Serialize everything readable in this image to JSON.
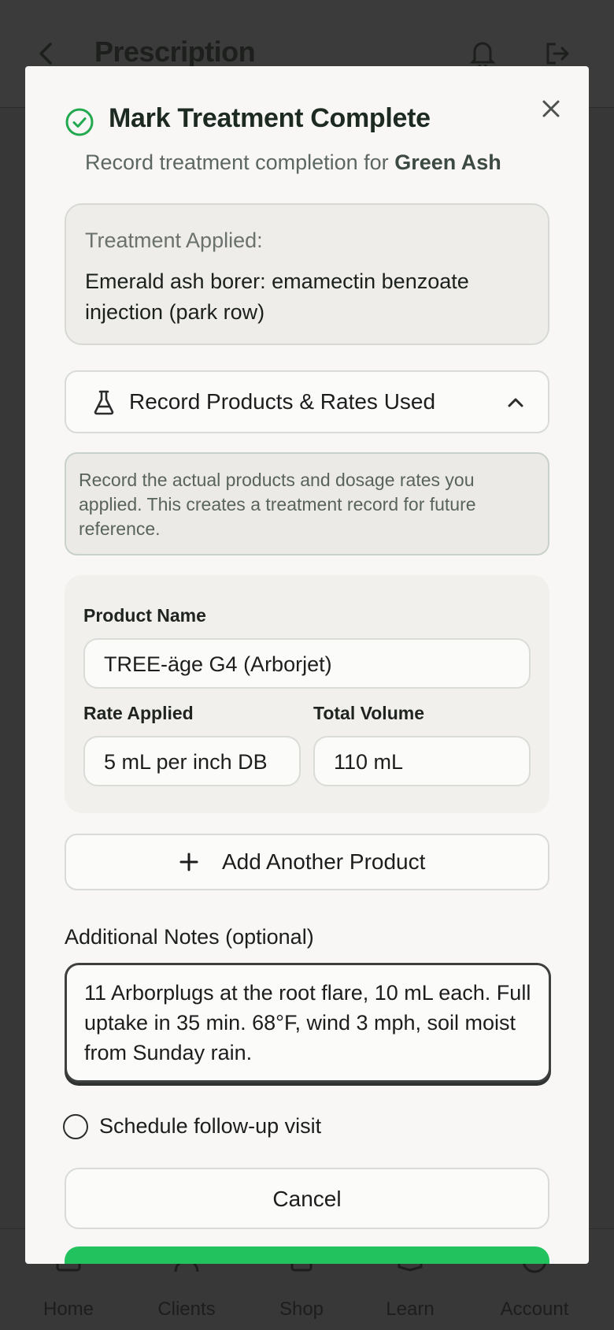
{
  "app": {
    "page_title": "Prescription",
    "tabs": [
      {
        "label": "Home",
        "icon": "home-icon"
      },
      {
        "label": "Clients",
        "icon": "users-icon"
      },
      {
        "label": "Shop",
        "icon": "bag-icon"
      },
      {
        "label": "Learn",
        "icon": "book-icon"
      },
      {
        "label": "Account",
        "icon": "user-icon"
      }
    ]
  },
  "modal": {
    "title": "Mark Treatment Complete",
    "subtitle_prefix": "Record treatment completion for ",
    "tree_name": "Green Ash",
    "applied": {
      "label": "Treatment Applied:",
      "text": "Emerald ash borer: emamectin benzoate injection (park row)"
    },
    "products_section": {
      "label": "Record Products & Rates Used",
      "expanded": true,
      "info": "Record the actual products and dosage rates you applied. This creates a treatment record for future reference."
    },
    "product": {
      "name_label": "Product Name",
      "name_value": "TREE-äge G4 (Arborjet)",
      "rate_label": "Rate Applied",
      "rate_value": "5 mL per inch DB",
      "volume_label": "Total Volume",
      "volume_value": "110 mL"
    },
    "add_product_label": "Add Another Product",
    "notes": {
      "label": "Additional Notes (optional)",
      "value": "11 Arborplugs at the root flare, 10 mL each. Full uptake in 35 min. 68°F, wind 3 mph, soil moist from Sunday rain."
    },
    "followup": {
      "label": "Schedule follow-up visit",
      "checked": false
    },
    "cancel_label": "Cancel"
  },
  "colors": {
    "accent_green": "#22c35e",
    "check_green": "#22a94f"
  }
}
